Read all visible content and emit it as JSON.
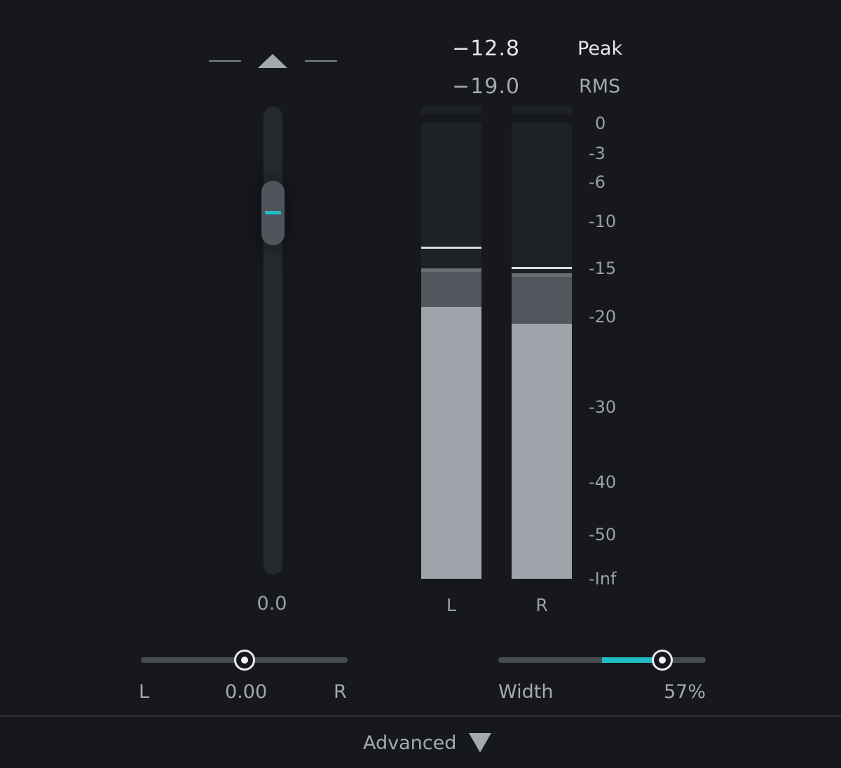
{
  "fader": {
    "value_label": "0.0",
    "handle_position_fraction": 0.14,
    "accent_color": "#1fbcc3"
  },
  "readouts": {
    "peak_value": "−12.8",
    "peak_label": "Peak",
    "rms_value": "−19.0",
    "rms_label": "RMS"
  },
  "meters": {
    "channels": [
      {
        "label": "L",
        "peak_hold_db": -12.8,
        "peak_db": -15,
        "rms_db": -19.0
      },
      {
        "label": "R",
        "peak_hold_db": -15,
        "peak_db": -15.5,
        "rms_db": -20.8
      }
    ],
    "scale": [
      {
        "label": "0",
        "db": 0
      },
      {
        "label": "-3",
        "db": -3
      },
      {
        "label": "-6",
        "db": -6
      },
      {
        "label": "-10",
        "db": -10
      },
      {
        "label": "-15",
        "db": -15
      },
      {
        "label": "-20",
        "db": -20
      },
      {
        "label": "-30",
        "db": -30
      },
      {
        "label": "-40",
        "db": -40
      },
      {
        "label": "-50",
        "db": -50
      },
      {
        "label": "-Inf",
        "db": -60
      }
    ]
  },
  "pan": {
    "left_label": "L",
    "value_label": "0.00",
    "right_label": "R",
    "position_fraction": 0.5
  },
  "width": {
    "label": "Width",
    "value_label": "57%",
    "position_fraction": 0.79,
    "fill_start_fraction": 0.5
  },
  "footer": {
    "advanced_label": "Advanced"
  }
}
